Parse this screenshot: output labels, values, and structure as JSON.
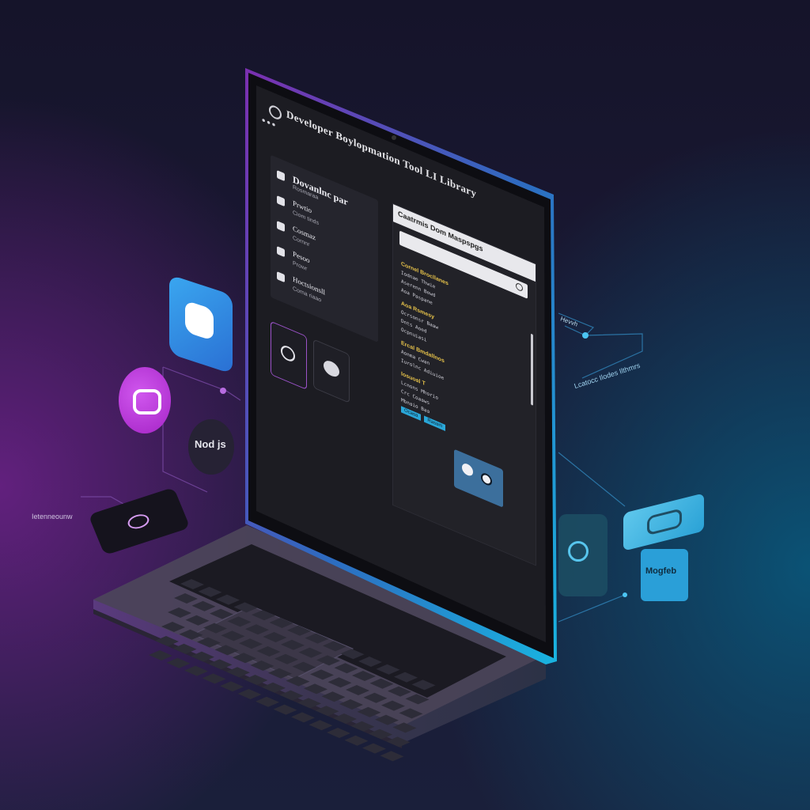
{
  "app": {
    "title": "Developer Boylopmation Tool LI Library"
  },
  "window_controls": {
    "dots": "•••"
  },
  "sidebar": {
    "header": "Dovanlnc par",
    "items": [
      {
        "icon": "bookmark-icon",
        "label": "Dovanlnc par",
        "sub": "Rosmaraa"
      },
      {
        "icon": "flag-icon",
        "label": "Prwtio",
        "sub": "Ciom tinds"
      },
      {
        "icon": "circle-icon",
        "label": "Cosmaz",
        "sub": "Cornnr"
      },
      {
        "icon": "gift-icon",
        "label": "Pesoo",
        "sub": "Prowr"
      },
      {
        "icon": "cube-icon",
        "label": "Hoctsionsll",
        "sub": "Coma riaao"
      }
    ]
  },
  "panel": {
    "title": "Caatrmis Dom Maspspgs",
    "search_placeholder": "",
    "sections": [
      {
        "heading": "Cornel Brocllanes",
        "lines": [
          "Iodnae Thwie",
          "Aserenn Bewd",
          "Aoa Paspane"
        ]
      },
      {
        "heading": "Aoa Rsmesy",
        "lines": [
          "Ocrsonsr Baaw",
          "Dnts Aoed",
          "Ocpnuiasi"
        ]
      },
      {
        "heading": "Ercal Bmdallnos",
        "lines": [
          "Aonma Cwan",
          "Iurolnc Adiuioe"
        ]
      },
      {
        "heading": "Iosuoal T",
        "lines": [
          "Lcnons Mhorio",
          "Crc Coaaws",
          "Mbnaio Baa"
        ]
      }
    ],
    "tab_labels": [
      "Ocasa",
      "Rasam"
    ]
  },
  "bottom_tiles": [
    {
      "icon": "search-icon"
    },
    {
      "icon": "logo-icon"
    }
  ],
  "floating": {
    "node_label": "Nod js",
    "left_caption": "Ietenneounw",
    "right_caption": "Lcatocc Ilodes Ilthmrs",
    "right_top_caption": "Hevvh",
    "mysql_label": "Mogfeb"
  },
  "colors": {
    "accent_purple": "#b13ad6",
    "accent_blue": "#2aa7d8",
    "screen_bg": "#1c1c22",
    "panel_bg": "#232329"
  }
}
